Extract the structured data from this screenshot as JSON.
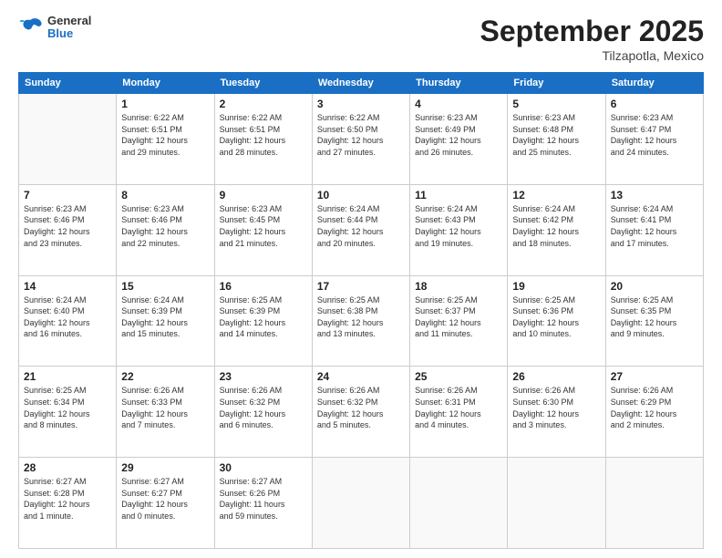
{
  "header": {
    "logo_general": "General",
    "logo_blue": "Blue",
    "month_title": "September 2025",
    "location": "Tilzapotla, Mexico"
  },
  "weekdays": [
    "Sunday",
    "Monday",
    "Tuesday",
    "Wednesday",
    "Thursday",
    "Friday",
    "Saturday"
  ],
  "weeks": [
    [
      {
        "day": "",
        "info": ""
      },
      {
        "day": "1",
        "info": "Sunrise: 6:22 AM\nSunset: 6:51 PM\nDaylight: 12 hours\nand 29 minutes."
      },
      {
        "day": "2",
        "info": "Sunrise: 6:22 AM\nSunset: 6:51 PM\nDaylight: 12 hours\nand 28 minutes."
      },
      {
        "day": "3",
        "info": "Sunrise: 6:22 AM\nSunset: 6:50 PM\nDaylight: 12 hours\nand 27 minutes."
      },
      {
        "day": "4",
        "info": "Sunrise: 6:23 AM\nSunset: 6:49 PM\nDaylight: 12 hours\nand 26 minutes."
      },
      {
        "day": "5",
        "info": "Sunrise: 6:23 AM\nSunset: 6:48 PM\nDaylight: 12 hours\nand 25 minutes."
      },
      {
        "day": "6",
        "info": "Sunrise: 6:23 AM\nSunset: 6:47 PM\nDaylight: 12 hours\nand 24 minutes."
      }
    ],
    [
      {
        "day": "7",
        "info": "Sunrise: 6:23 AM\nSunset: 6:46 PM\nDaylight: 12 hours\nand 23 minutes."
      },
      {
        "day": "8",
        "info": "Sunrise: 6:23 AM\nSunset: 6:46 PM\nDaylight: 12 hours\nand 22 minutes."
      },
      {
        "day": "9",
        "info": "Sunrise: 6:23 AM\nSunset: 6:45 PM\nDaylight: 12 hours\nand 21 minutes."
      },
      {
        "day": "10",
        "info": "Sunrise: 6:24 AM\nSunset: 6:44 PM\nDaylight: 12 hours\nand 20 minutes."
      },
      {
        "day": "11",
        "info": "Sunrise: 6:24 AM\nSunset: 6:43 PM\nDaylight: 12 hours\nand 19 minutes."
      },
      {
        "day": "12",
        "info": "Sunrise: 6:24 AM\nSunset: 6:42 PM\nDaylight: 12 hours\nand 18 minutes."
      },
      {
        "day": "13",
        "info": "Sunrise: 6:24 AM\nSunset: 6:41 PM\nDaylight: 12 hours\nand 17 minutes."
      }
    ],
    [
      {
        "day": "14",
        "info": "Sunrise: 6:24 AM\nSunset: 6:40 PM\nDaylight: 12 hours\nand 16 minutes."
      },
      {
        "day": "15",
        "info": "Sunrise: 6:24 AM\nSunset: 6:39 PM\nDaylight: 12 hours\nand 15 minutes."
      },
      {
        "day": "16",
        "info": "Sunrise: 6:25 AM\nSunset: 6:39 PM\nDaylight: 12 hours\nand 14 minutes."
      },
      {
        "day": "17",
        "info": "Sunrise: 6:25 AM\nSunset: 6:38 PM\nDaylight: 12 hours\nand 13 minutes."
      },
      {
        "day": "18",
        "info": "Sunrise: 6:25 AM\nSunset: 6:37 PM\nDaylight: 12 hours\nand 11 minutes."
      },
      {
        "day": "19",
        "info": "Sunrise: 6:25 AM\nSunset: 6:36 PM\nDaylight: 12 hours\nand 10 minutes."
      },
      {
        "day": "20",
        "info": "Sunrise: 6:25 AM\nSunset: 6:35 PM\nDaylight: 12 hours\nand 9 minutes."
      }
    ],
    [
      {
        "day": "21",
        "info": "Sunrise: 6:25 AM\nSunset: 6:34 PM\nDaylight: 12 hours\nand 8 minutes."
      },
      {
        "day": "22",
        "info": "Sunrise: 6:26 AM\nSunset: 6:33 PM\nDaylight: 12 hours\nand 7 minutes."
      },
      {
        "day": "23",
        "info": "Sunrise: 6:26 AM\nSunset: 6:32 PM\nDaylight: 12 hours\nand 6 minutes."
      },
      {
        "day": "24",
        "info": "Sunrise: 6:26 AM\nSunset: 6:32 PM\nDaylight: 12 hours\nand 5 minutes."
      },
      {
        "day": "25",
        "info": "Sunrise: 6:26 AM\nSunset: 6:31 PM\nDaylight: 12 hours\nand 4 minutes."
      },
      {
        "day": "26",
        "info": "Sunrise: 6:26 AM\nSunset: 6:30 PM\nDaylight: 12 hours\nand 3 minutes."
      },
      {
        "day": "27",
        "info": "Sunrise: 6:26 AM\nSunset: 6:29 PM\nDaylight: 12 hours\nand 2 minutes."
      }
    ],
    [
      {
        "day": "28",
        "info": "Sunrise: 6:27 AM\nSunset: 6:28 PM\nDaylight: 12 hours\nand 1 minute."
      },
      {
        "day": "29",
        "info": "Sunrise: 6:27 AM\nSunset: 6:27 PM\nDaylight: 12 hours\nand 0 minutes."
      },
      {
        "day": "30",
        "info": "Sunrise: 6:27 AM\nSunset: 6:26 PM\nDaylight: 11 hours\nand 59 minutes."
      },
      {
        "day": "",
        "info": ""
      },
      {
        "day": "",
        "info": ""
      },
      {
        "day": "",
        "info": ""
      },
      {
        "day": "",
        "info": ""
      }
    ]
  ]
}
